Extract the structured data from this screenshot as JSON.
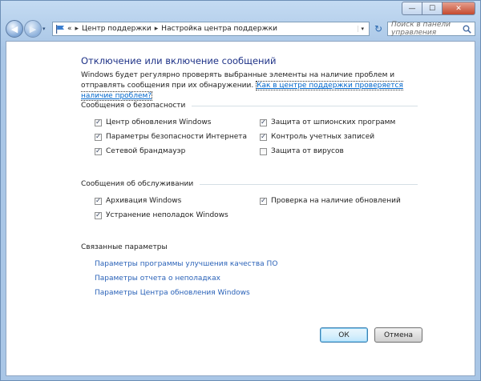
{
  "window": {
    "minimize": "—",
    "maximize": "☐",
    "close": "✕"
  },
  "toolbar": {
    "back_icon": "back-arrow-icon",
    "forward_icon": "forward-arrow-icon",
    "crumb_prefix": "«",
    "breadcrumbs": [
      "Центр поддержки",
      "Настройка центра поддержки"
    ],
    "crumb_separator": "▸",
    "dropdown": "▾",
    "refresh": "↻",
    "search_placeholder": "Поиск в панели управления",
    "search_icon": "search-icon"
  },
  "page": {
    "title": "Отключение или включение сообщений",
    "description": "Windows будет регулярно проверять выбранные элементы на наличие проблем и отправлять сообщения при их обнаружении. ",
    "description_link": "Как в центре поддержки проверяется наличие проблем?"
  },
  "security": {
    "heading": "Сообщения о безопасности",
    "items": [
      {
        "label": "Центр обновления Windows",
        "checked": true
      },
      {
        "label": "Защита от шпионских программ",
        "checked": true
      },
      {
        "label": "Параметры безопасности Интернета",
        "checked": true
      },
      {
        "label": "Контроль учетных записей",
        "checked": true
      },
      {
        "label": "Сетевой брандмауэр",
        "checked": true
      },
      {
        "label": "Защита от вирусов",
        "checked": false
      }
    ]
  },
  "maintenance": {
    "heading": "Сообщения об обслуживании",
    "items": [
      {
        "label": "Архивация Windows",
        "checked": true
      },
      {
        "label": "Проверка на наличие обновлений",
        "checked": true
      },
      {
        "label": "Устранение неполадок Windows",
        "checked": true
      }
    ]
  },
  "related": {
    "heading": "Связанные параметры",
    "links": [
      "Параметры программы улучшения качества ПО",
      "Параметры отчета о неполадках",
      "Параметры Центра обновления Windows"
    ]
  },
  "buttons": {
    "ok": "ОК",
    "cancel": "Отмена"
  },
  "check_mark": "✓"
}
